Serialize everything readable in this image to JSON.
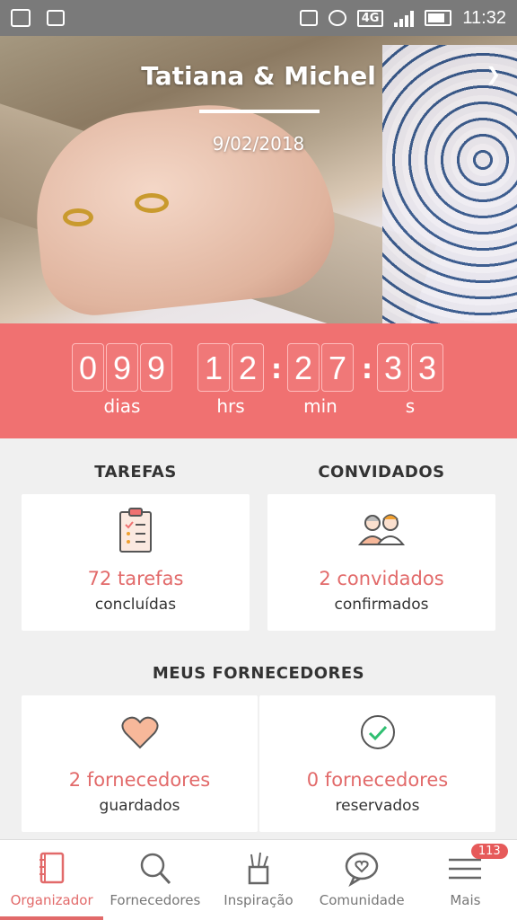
{
  "statusbar": {
    "network": "4G",
    "time": "11:32"
  },
  "hero": {
    "title": "Tatiana & Michel",
    "date": "9/02/2018"
  },
  "countdown": {
    "days": [
      "0",
      "9",
      "9"
    ],
    "hours": [
      "1",
      "2"
    ],
    "minutes": [
      "2",
      "7"
    ],
    "seconds": [
      "3",
      "3"
    ],
    "labels": {
      "days": "dias",
      "hours": "hrs",
      "minutes": "min",
      "seconds": "s"
    },
    "separator": ":"
  },
  "tasks": {
    "title": "TAREFAS",
    "count": "72 tarefas",
    "sub": "concluídas",
    "icon": "clipboard-checklist-icon"
  },
  "guests": {
    "title": "CONVIDADOS",
    "count": "2 convidados",
    "sub": "confirmados",
    "icon": "couple-icon"
  },
  "vendors": {
    "title": "MEUS FORNECEDORES",
    "saved": {
      "count": "2 fornecedores",
      "sub": "guardados",
      "icon": "heart-icon"
    },
    "booked": {
      "count": "0 fornecedores",
      "sub": "reservados",
      "icon": "check-circle-icon"
    }
  },
  "bottomnav": {
    "items": [
      {
        "label": "Organizador",
        "icon": "notebook-icon",
        "active": true
      },
      {
        "label": "Fornecedores",
        "icon": "search-icon",
        "active": false
      },
      {
        "label": "Inspiração",
        "icon": "brush-cup-icon",
        "active": false
      },
      {
        "label": "Comunidade",
        "icon": "chat-heart-icon",
        "active": false
      },
      {
        "label": "Mais",
        "icon": "menu-icon",
        "active": false,
        "badge": "113"
      }
    ]
  },
  "colors": {
    "accent": "#f07171",
    "accent_text": "#e26a6a"
  }
}
